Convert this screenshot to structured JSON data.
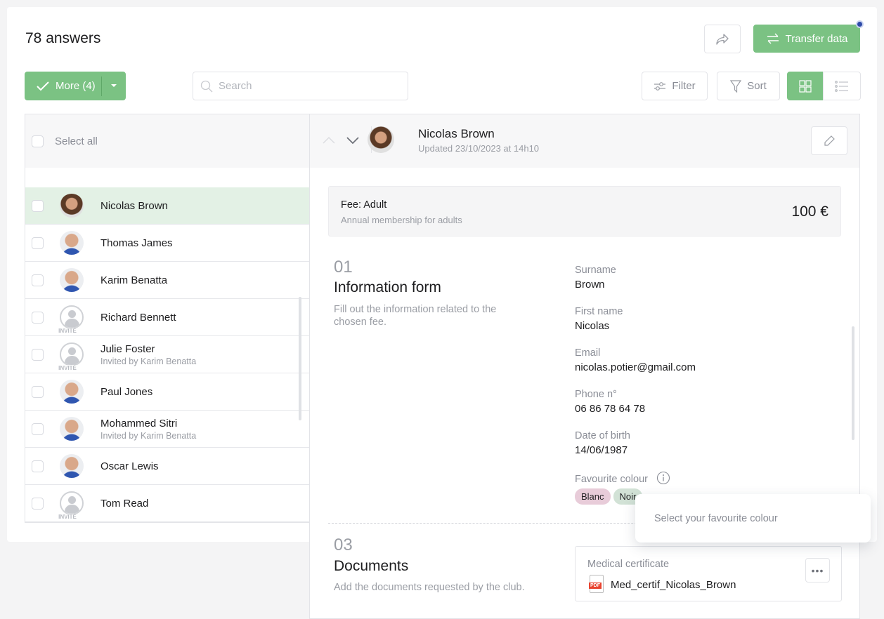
{
  "header": {
    "title": "78 answers",
    "transfer_label": "Transfer data"
  },
  "toolbar": {
    "more_label": "More (4)",
    "search_placeholder": "Search",
    "filter_label": "Filter",
    "sort_label": "Sort"
  },
  "list": {
    "select_all": "Select all",
    "invite_badge": "INVITÉ",
    "items": [
      {
        "name": "Nicolas Brown",
        "sub": "",
        "avatar": "photo",
        "selected": true
      },
      {
        "name": "Thomas James",
        "sub": "",
        "avatar": "photo"
      },
      {
        "name": "Karim Benatta",
        "sub": "",
        "avatar": "photo"
      },
      {
        "name": "Richard Bennett",
        "sub": "",
        "avatar": "invite"
      },
      {
        "name": "Julie Foster",
        "sub": "Invited by Karim Benatta",
        "avatar": "invite"
      },
      {
        "name": "Paul Jones",
        "sub": "",
        "avatar": "photo"
      },
      {
        "name": "Mohammed Sitri",
        "sub": "Invited by Karim Benatta",
        "avatar": "photo"
      },
      {
        "name": "Oscar Lewis",
        "sub": "",
        "avatar": "photo"
      },
      {
        "name": "Tom Read",
        "sub": "",
        "avatar": "invite"
      }
    ]
  },
  "detail": {
    "name": "Nicolas Brown",
    "updated": "Updated 23/10/2023 at 14h10",
    "fee": {
      "title": "Fee: Adult",
      "desc": "Annual membership for adults",
      "price": "100 €"
    },
    "section1": {
      "num": "01",
      "title": "Information form",
      "desc": "Fill out the information related to the chosen fee.",
      "fields": [
        {
          "label": "Surname",
          "value": "Brown"
        },
        {
          "label": "First name",
          "value": "Nicolas"
        },
        {
          "label": "Email",
          "value": "nicolas.potier@gmail.com"
        },
        {
          "label": "Phone n°",
          "value": "06 86 78 64 78"
        },
        {
          "label": "Date of birth",
          "value": "14/06/1987"
        }
      ],
      "colour_label": "Favourite colour",
      "chips": [
        "Blanc",
        "Noir"
      ],
      "tooltip": "Select your favourite colour"
    },
    "section3": {
      "num": "03",
      "title": "Documents",
      "desc": "Add the documents requested by the club.",
      "doc_label": "Medical certificate",
      "file_name": "Med_certif_Nicolas_Brown",
      "file_badge": "PDF"
    }
  },
  "colors": {
    "accent": "#7bc283",
    "selected_row": "#e3f1e5",
    "notification_dot": "#2e4aa8",
    "chip_blanc": "#e8ccd9",
    "chip_noir": "#d2e2d6"
  }
}
